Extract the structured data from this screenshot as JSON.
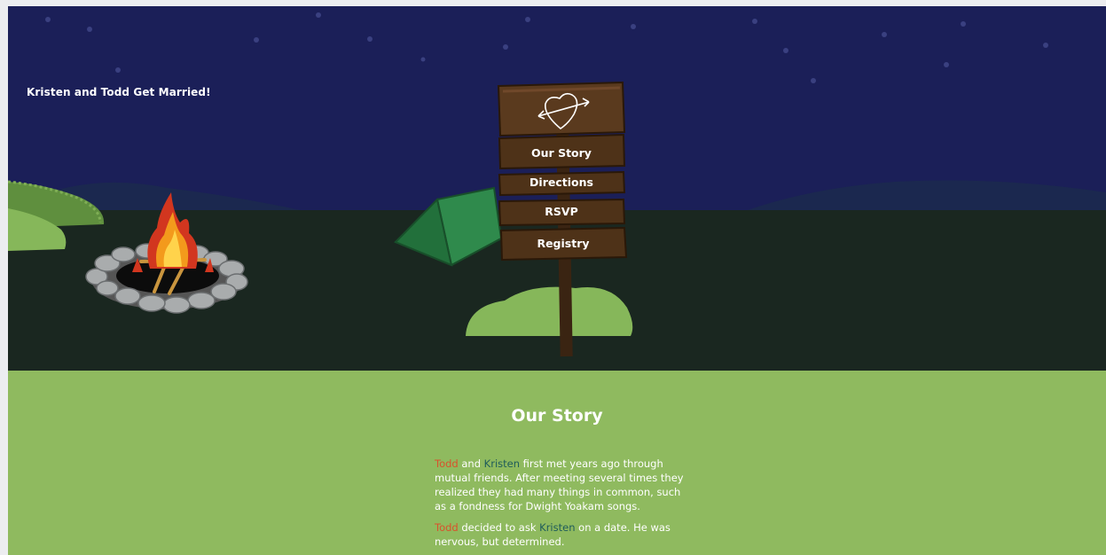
{
  "site": {
    "title": "Kristen and Todd Get Married!"
  },
  "nav": {
    "items": [
      {
        "label": "Our Story"
      },
      {
        "label": "Directions"
      },
      {
        "label": "RSVP"
      },
      {
        "label": "Registry"
      }
    ]
  },
  "story": {
    "heading": "Our Story",
    "p1": {
      "name1": "Todd",
      "join": " and ",
      "name2": "Kristen",
      "rest": " first met years ago through mutual friends. After meeting several times they realized they had many things in common, such as a fondness for Dwight Yoakam songs."
    },
    "p2": {
      "name1": "Todd",
      "mid": " decided to ask ",
      "name2": "Kristen",
      "rest": " on a date. He was nervous, but determined."
    }
  },
  "colors": {
    "sky": "#1b1f58",
    "ground": "#1a2720",
    "grass": "#8fba5f",
    "todd_name": "#d9512c",
    "kristen_name": "#1f5c5a"
  }
}
